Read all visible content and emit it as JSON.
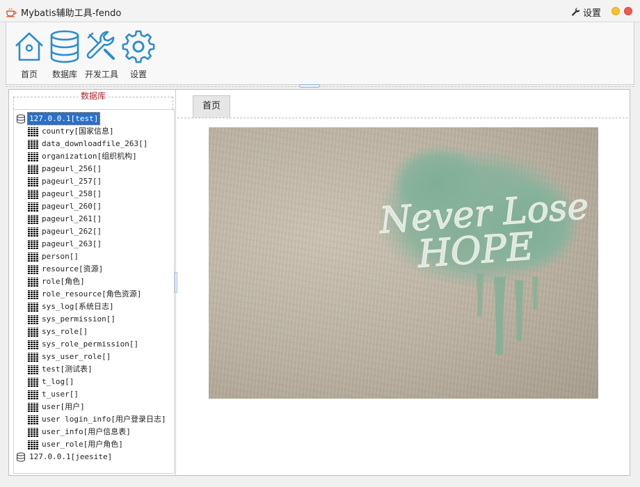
{
  "window": {
    "title": "Mybatis辅助工具-fendo",
    "settings_label": "设置",
    "min_color": "#f7c22c",
    "close_color": "#f05a4e"
  },
  "toolbar": {
    "accent": "#2b8ccf",
    "items": [
      {
        "label": "首页",
        "icon": "home-icon"
      },
      {
        "label": "数据库",
        "icon": "database-icon"
      },
      {
        "label": "开发工具",
        "icon": "wrench-icon"
      },
      {
        "label": "设置",
        "icon": "gear-icon"
      }
    ]
  },
  "left_panel": {
    "title": "数据库",
    "connections": [
      {
        "label": "127.0.0.1[test]",
        "selected": true,
        "tables": [
          "country[国家信息]",
          "data_downloadfile_263[]",
          "organization[组织机构]",
          "pageurl_256[]",
          "pageurl_257[]",
          "pageurl_258[]",
          "pageurl_260[]",
          "pageurl_261[]",
          "pageurl_262[]",
          "pageurl_263[]",
          "person[]",
          "resource[资源]",
          "role[角色]",
          "role_resource[角色资源]",
          "sys_log[系统日志]",
          "sys_permission[]",
          "sys_role[]",
          "sys_role_permission[]",
          "sys_user_role[]",
          "test[测试表]",
          "t_log[]",
          "t_user[]",
          "user[用户]",
          "user login_info[用户登录日志]",
          "user_info[用户信息表]",
          "user_role[用户角色]"
        ]
      },
      {
        "label": "127.0.0.1[jeesite]",
        "selected": false,
        "tables": []
      }
    ]
  },
  "right_panel": {
    "tab_label": "首页",
    "graffiti_text": [
      "Never Lose",
      "HOPE"
    ]
  }
}
